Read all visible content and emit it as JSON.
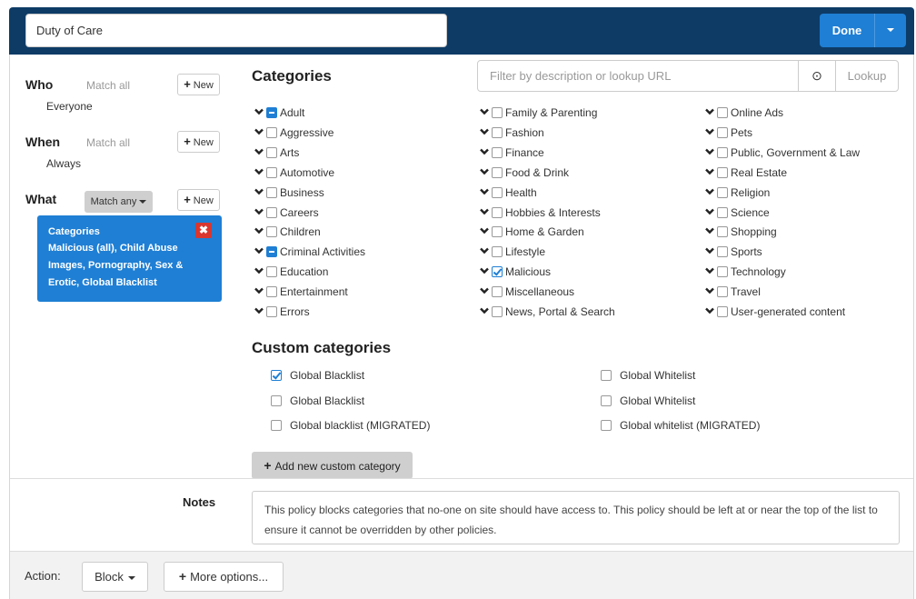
{
  "header": {
    "policy_name": "Duty of Care",
    "done_label": "Done"
  },
  "rules": {
    "who": {
      "label": "Who",
      "match": "Match all",
      "value": "Everyone",
      "new_label": "New"
    },
    "when": {
      "label": "When",
      "match": "Match all",
      "value": "Always",
      "new_label": "New"
    },
    "what": {
      "label": "What",
      "match": "Match any",
      "new_label": "New",
      "card_title": "Categories",
      "card_desc": "Malicious (all), Child Abuse Images, Pornography, Sex & Erotic, Global Blacklist",
      "close_symbol": "✖"
    }
  },
  "categories": {
    "title": "Categories",
    "filter_placeholder": "Filter by description or lookup URL",
    "clear_symbol": "⊙",
    "lookup_label": "Lookup",
    "columns": [
      [
        {
          "label": "Adult",
          "state": "partial"
        },
        {
          "label": "Aggressive",
          "state": "unchecked"
        },
        {
          "label": "Arts",
          "state": "unchecked"
        },
        {
          "label": "Automotive",
          "state": "unchecked"
        },
        {
          "label": "Business",
          "state": "unchecked"
        },
        {
          "label": "Careers",
          "state": "unchecked"
        },
        {
          "label": "Children",
          "state": "unchecked"
        },
        {
          "label": "Criminal Activities",
          "state": "partial"
        },
        {
          "label": "Education",
          "state": "unchecked"
        },
        {
          "label": "Entertainment",
          "state": "unchecked"
        },
        {
          "label": "Errors",
          "state": "unchecked"
        }
      ],
      [
        {
          "label": "Family & Parenting",
          "state": "unchecked"
        },
        {
          "label": "Fashion",
          "state": "unchecked"
        },
        {
          "label": "Finance",
          "state": "unchecked"
        },
        {
          "label": "Food & Drink",
          "state": "unchecked"
        },
        {
          "label": "Health",
          "state": "unchecked"
        },
        {
          "label": "Hobbies & Interests",
          "state": "unchecked"
        },
        {
          "label": "Home & Garden",
          "state": "unchecked"
        },
        {
          "label": "Lifestyle",
          "state": "unchecked"
        },
        {
          "label": "Malicious",
          "state": "checked"
        },
        {
          "label": "Miscellaneous",
          "state": "unchecked"
        },
        {
          "label": "News, Portal & Search",
          "state": "unchecked"
        }
      ],
      [
        {
          "label": "Online Ads",
          "state": "unchecked"
        },
        {
          "label": "Pets",
          "state": "unchecked"
        },
        {
          "label": "Public, Government & Law",
          "state": "unchecked"
        },
        {
          "label": "Real Estate",
          "state": "unchecked"
        },
        {
          "label": "Religion",
          "state": "unchecked"
        },
        {
          "label": "Science",
          "state": "unchecked"
        },
        {
          "label": "Shopping",
          "state": "unchecked"
        },
        {
          "label": "Sports",
          "state": "unchecked"
        },
        {
          "label": "Technology",
          "state": "unchecked"
        },
        {
          "label": "Travel",
          "state": "unchecked"
        },
        {
          "label": "User-generated content",
          "state": "unchecked"
        }
      ]
    ]
  },
  "custom_categories": {
    "title": "Custom categories",
    "left": [
      {
        "label": "Global Blacklist",
        "state": "checked"
      },
      {
        "label": "Global Blacklist",
        "state": "unchecked"
      },
      {
        "label": "Global blacklist (MIGRATED)",
        "state": "unchecked"
      }
    ],
    "right": [
      {
        "label": "Global Whitelist",
        "state": "unchecked"
      },
      {
        "label": "Global Whitelist",
        "state": "unchecked"
      },
      {
        "label": "Global whitelist (MIGRATED)",
        "state": "unchecked"
      }
    ],
    "add_label": "Add new custom category"
  },
  "notes": {
    "label": "Notes",
    "text": "This policy blocks categories that no-one on site should have access to. This policy should be left at or near the top of the list to ensure it cannot be overridden by other policies."
  },
  "footer": {
    "action_label": "Action:",
    "block_label": "Block",
    "more_label": "More options..."
  },
  "colors": {
    "header_bg": "#0d3b66",
    "accent": "#1f7fd4",
    "danger": "#d9362f"
  }
}
